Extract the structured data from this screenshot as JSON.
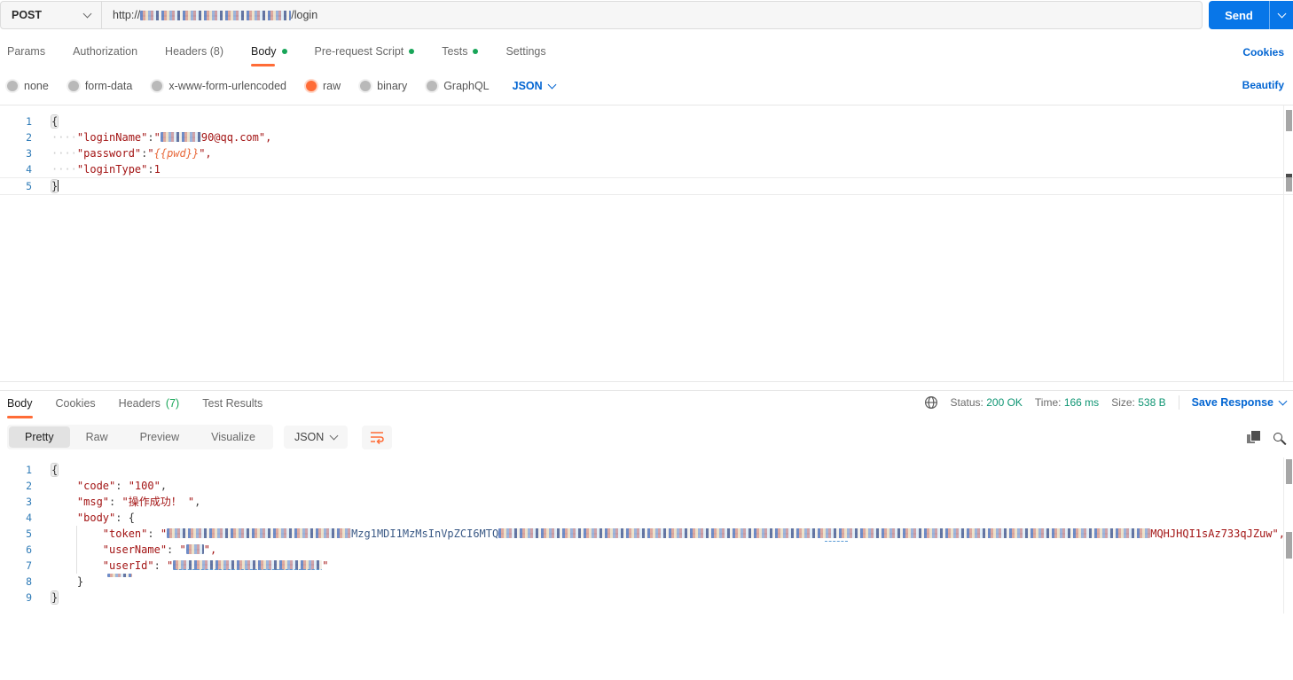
{
  "topbar": {
    "method": "POST",
    "url_prefix": "http://",
    "url_suffix": "/login",
    "send": "Send"
  },
  "tabs": {
    "params": "Params",
    "auth": "Authorization",
    "headers": "Headers (8)",
    "body": "Body",
    "pre": "Pre-request Script",
    "tests": "Tests",
    "settings": "Settings",
    "cookies": "Cookies"
  },
  "bodytype": {
    "none": "none",
    "formdata": "form-data",
    "urlencoded": "x-www-form-urlencoded",
    "raw": "raw",
    "binary": "binary",
    "graphql": "GraphQL",
    "lang": "JSON",
    "beautify": "Beautify"
  },
  "req": {
    "n1": "1",
    "n2": "2",
    "n3": "3",
    "n4": "4",
    "n5": "5",
    "l1": "{",
    "ws": "····",
    "l2k": "\"loginName\"",
    "l2c": ":",
    "l2q": "\"",
    "l2v": "90@qq.com\",",
    "l3k": "\"password\"",
    "l3c": ":",
    "l3q": "\"",
    "l3var": "{{pwd}}",
    "l3e": "\",",
    "l4k": "\"loginType\"",
    "l4c": ":",
    "l4v": "1",
    "l5": "}"
  },
  "resp": {
    "tabs": {
      "body": "Body",
      "cookies": "Cookies",
      "headers_label": "Headers ",
      "headers_count": "(7)",
      "results": "Test Results"
    },
    "meta": {
      "status_label": "Status:",
      "status": "200 OK",
      "time_label": "Time:",
      "time": "166 ms",
      "size_label": "Size:",
      "size": "538 B",
      "save": "Save Response"
    },
    "views": {
      "pretty": "Pretty",
      "raw": "Raw",
      "preview": "Preview",
      "visualize": "Visualize",
      "lang": "JSON"
    },
    "code": {
      "n1": "1",
      "n2": "2",
      "n3": "3",
      "n4": "4",
      "n5": "5",
      "n6": "6",
      "n7": "7",
      "n8": "8",
      "n9": "9",
      "l1": "{",
      "l2k": "    \"code\"",
      "l2c": ": ",
      "l2v": "\"100\"",
      "l2e": ",",
      "l3k": "    \"msg\"",
      "l3c": ": ",
      "l3v": "\"操作成功！ \"",
      "l3e": ",",
      "l4k": "    \"body\"",
      "l4c": ": ",
      "l4b": "{",
      "l5k": "        \"token\"",
      "l5c": ": ",
      "l5q": "\"",
      "l5mid": "Mzg1MDI1MzMsInVpZCI6MTQ",
      "l5tail": "MQHJHQI1sAz733qJZuw\",",
      "l6k": "        \"userName\"",
      "l6c": ": ",
      "l6q": "\"",
      "l6e": "\",",
      "l7k": "        \"userId\"",
      "l7c": ": ",
      "l7q": "\"",
      "l7e": "\"",
      "l8": "    }",
      "l9": "}"
    }
  }
}
